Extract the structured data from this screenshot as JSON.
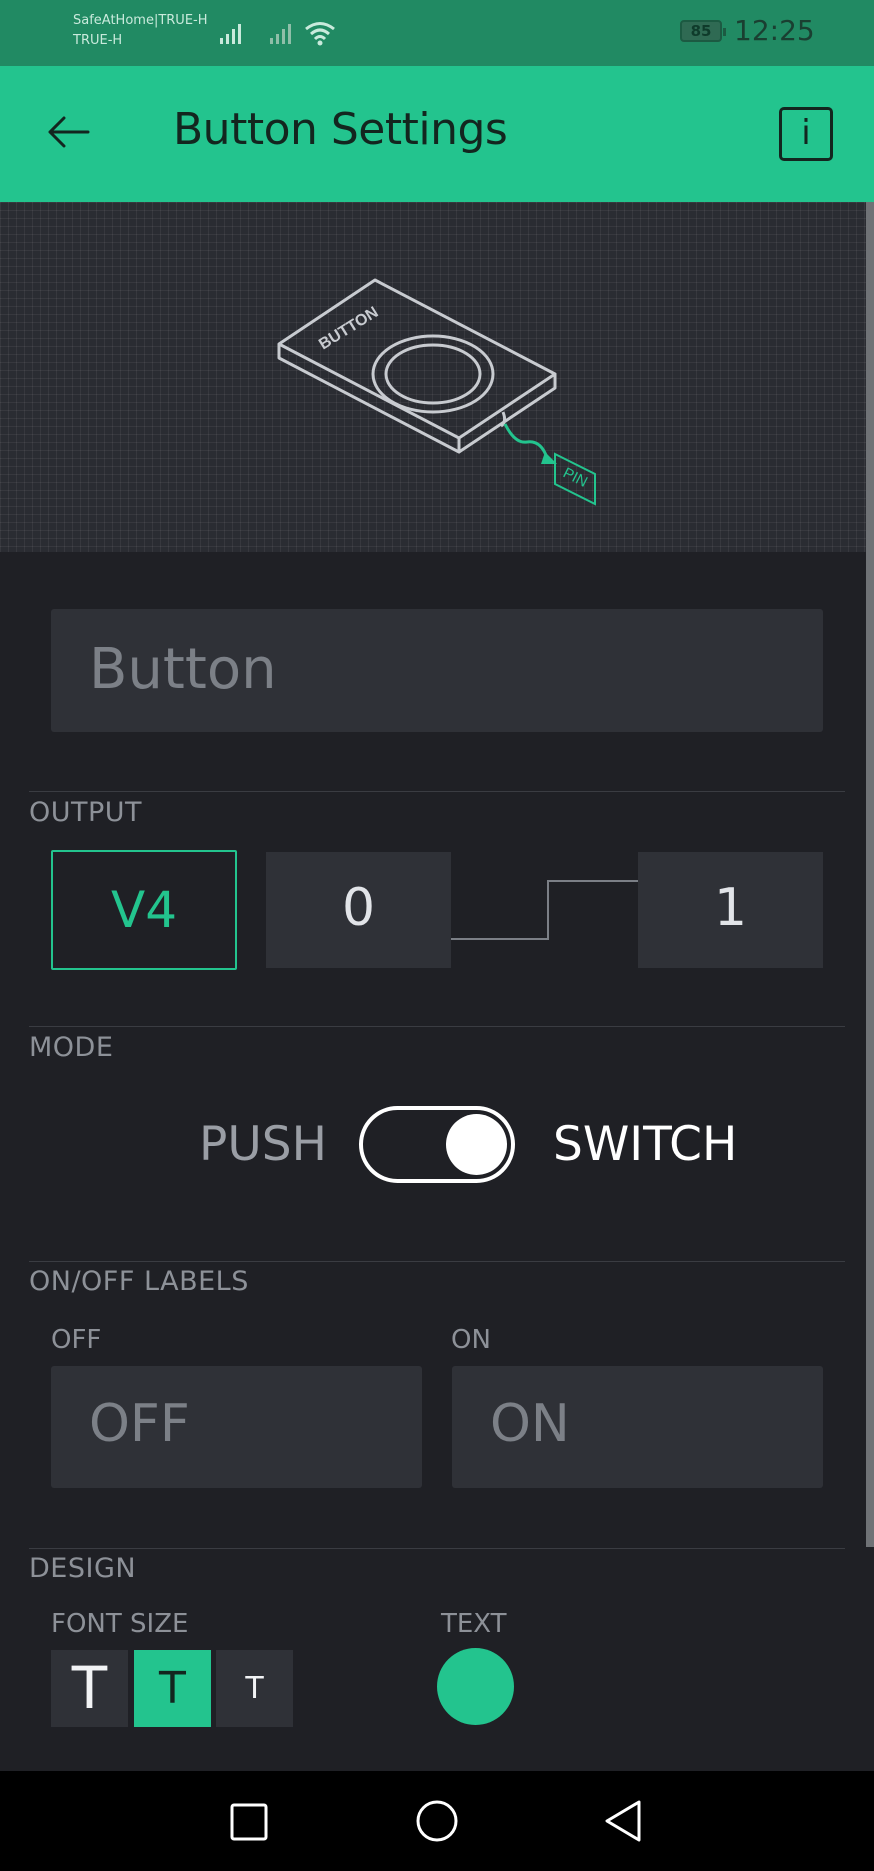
{
  "status_bar": {
    "carrier_line1": "SafeAtHome|TRUE-H",
    "carrier_line2": "TRUE-H",
    "battery": "85",
    "time": "12:25"
  },
  "header": {
    "title": "Button Settings",
    "info_label": "i"
  },
  "widget_name": {
    "placeholder": "Button"
  },
  "output": {
    "section_label": "OUTPUT",
    "pin": "V4",
    "low_value": "0",
    "high_value": "1"
  },
  "mode": {
    "section_label": "MODE",
    "left_label": "PUSH",
    "right_label": "SWITCH",
    "selected": "SWITCH"
  },
  "labels": {
    "section_label": "ON/OFF LABELS",
    "off_title": "OFF",
    "off_placeholder": "OFF",
    "on_title": "ON",
    "on_placeholder": "ON"
  },
  "design": {
    "section_label": "DESIGN",
    "font_size_label": "FONT SIZE",
    "font_sizes": [
      "T",
      "T",
      "T"
    ],
    "selected_font_size": 1,
    "text_label": "TEXT",
    "text_color": "#23c48e"
  },
  "illustration": {
    "device_label": "BUTTON",
    "pin_label": "PIN"
  },
  "colors": {
    "accent": "#23c48e",
    "status_bar": "#218a63",
    "background": "#1f2025"
  }
}
